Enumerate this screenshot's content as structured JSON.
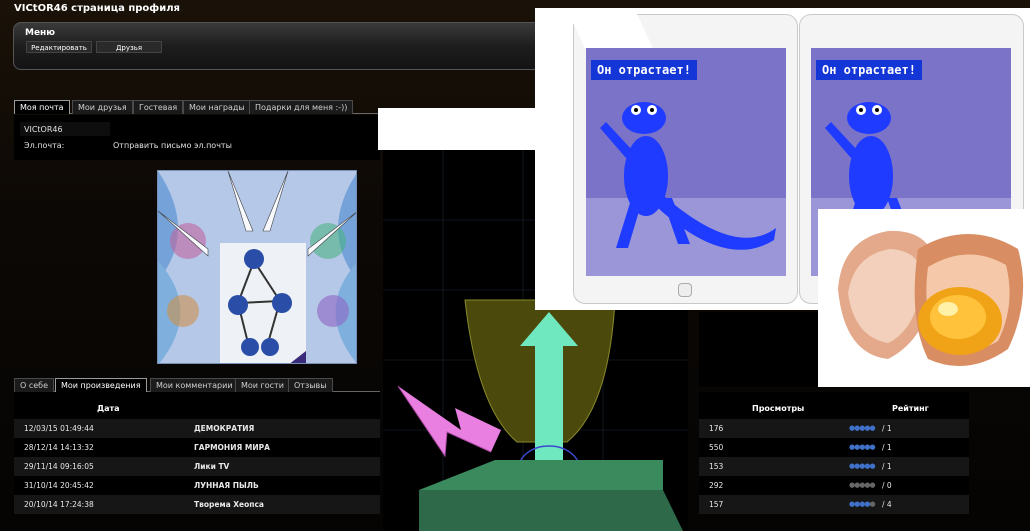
{
  "page": {
    "title": "VICtOR46 страница профиля"
  },
  "menu": {
    "title": "Меню",
    "edit_label": "Редактировать",
    "friends_label": "Друзья"
  },
  "profile_tabs": [
    "Моя почта",
    "Мои друзья",
    "Гостевая",
    "Мои награды",
    "Подарки для меня :-))"
  ],
  "info": {
    "nickname": "VICtOR46",
    "email_label": "Эл.почта:",
    "email_action": "Отправить письмо эл.почты"
  },
  "works_tabs": [
    "О себе",
    "Мои произведения",
    "Мои комментарии",
    "Мои гости",
    "Отзывы"
  ],
  "works_table": {
    "date_header": "Дата",
    "rows": [
      {
        "date": "12/03/15 01:49:44",
        "title": "ДЕМОКРАТИЯ"
      },
      {
        "date": "28/12/14 14:13:32",
        "title": "ГАРМОНИЯ МИРА"
      },
      {
        "date": "29/11/14 09:16:05",
        "title": "Лики TV"
      },
      {
        "date": "31/10/14 20:45:42",
        "title": "ЛУННАЯ ПЫЛЬ"
      },
      {
        "date": "20/10/14 17:24:38",
        "title": "Творема Хеопса"
      }
    ]
  },
  "stats_table": {
    "views_header": "Просмотры",
    "rating_header": "Рейтинг",
    "rows": [
      {
        "views": "176",
        "rating": 5,
        "votes": "/ 1"
      },
      {
        "views": "550",
        "rating": 5,
        "votes": "/ 1"
      },
      {
        "views": "153",
        "rating": 5,
        "votes": "/ 1"
      },
      {
        "views": "292",
        "rating": 0,
        "votes": "/ 0"
      },
      {
        "views": "157",
        "rating": 4,
        "votes": "/ 4"
      }
    ]
  },
  "overlay": {
    "banner_text": "Он отрастает!"
  },
  "colors": {
    "banner": "#1536d6",
    "rating_dot": "#3f71c8",
    "arrow_magenta": "#e97fe0",
    "arrow_cyan": "#6ff0c8"
  }
}
